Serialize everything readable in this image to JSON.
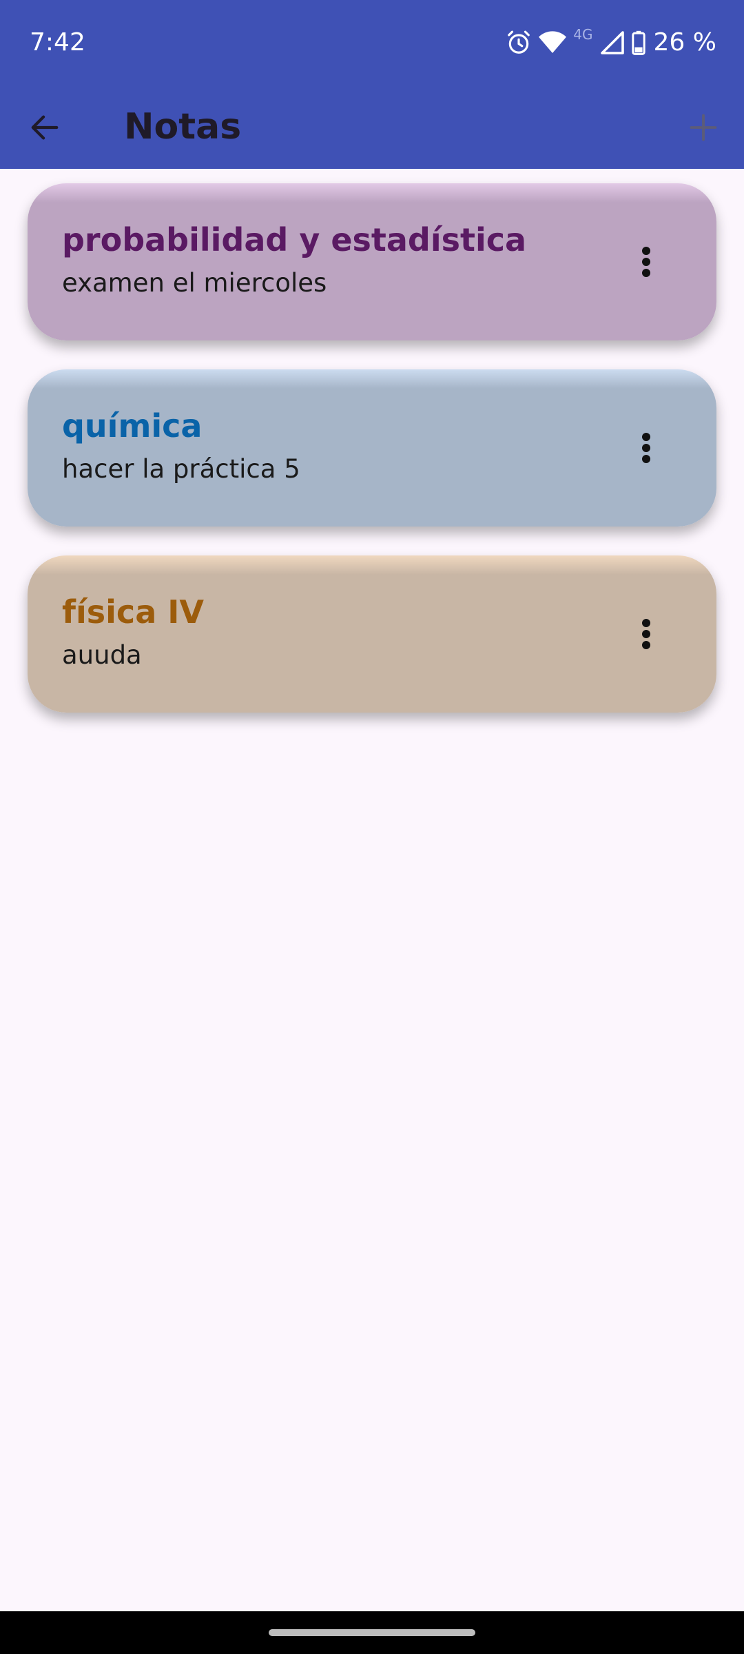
{
  "status": {
    "time": "7:42",
    "network": "4G",
    "battery": "26 %"
  },
  "appbar": {
    "title": "Notas",
    "back_icon": "arrow-left-icon",
    "add_icon": "plus-icon"
  },
  "notes": [
    {
      "title": "probabilidad y estadística",
      "body": "examen el miercoles",
      "title_color": "#5a1a63",
      "card_color": "#bca4c1",
      "card_top_color": "#e2c9e6"
    },
    {
      "title": "química",
      "body": "hacer la práctica 5",
      "title_color": "#0a63a8",
      "card_color": "#a6b5c8",
      "card_top_color": "#ccdcf0"
    },
    {
      "title": "física IV",
      "body": "auuda",
      "title_color": "#9c5c0c",
      "card_color": "#c8b6a5",
      "card_top_color": "#f0d8bf"
    }
  ],
  "colors": {
    "primary": "#3f51b5",
    "background": "#fcf6fd"
  }
}
